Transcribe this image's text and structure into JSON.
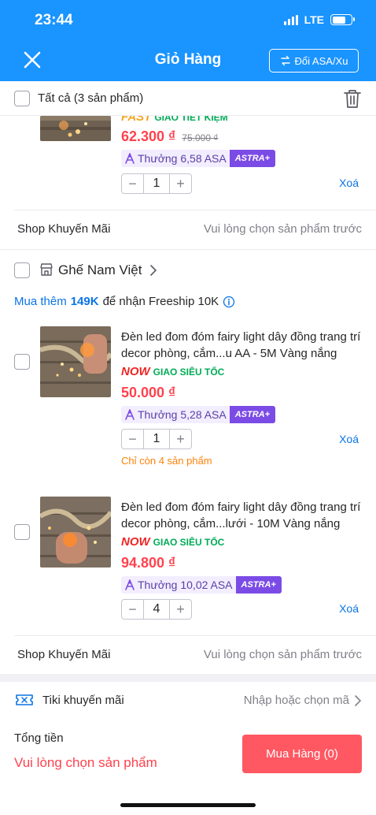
{
  "status": {
    "time": "23:44",
    "network": "LTE"
  },
  "header": {
    "title": "Giỏ Hàng",
    "exchange_label": "Đổi ASA/Xu"
  },
  "select_all": {
    "label": "Tất cả (3 sản phẩm)"
  },
  "colors": {
    "brand_blue": "#1a94ff",
    "price_red": "#ff424e",
    "link_blue": "#0b74e5",
    "astra_purple": "#7b4be6"
  },
  "items": [
    {
      "delivery_brand": "FAST",
      "delivery_text": "GIAO TIẾT KIỆM",
      "price": "62.300 ₫",
      "old_price": "75.000 ₫",
      "reward": "Thưởng 6,58 ASA",
      "reward_tag": "ASTRA+",
      "quantity": "1",
      "remove": "Xoá"
    },
    {
      "name": "Đèn led đom đóm fairy light dây đồng trang trí decor phòng, cắm...u AA - 5M Vàng nắng",
      "delivery_brand": "NOW",
      "delivery_text": "GIAO SIÊU TỐC",
      "price": "50.000 ₫",
      "reward": "Thưởng 5,28 ASA",
      "reward_tag": "ASTRA+",
      "quantity": "1",
      "remove": "Xoá",
      "stock_note": "Chỉ còn 4 sản phẩm"
    },
    {
      "name": "Đèn led đom đóm fairy light dây đồng trang trí decor phòng, cắm...lưới - 10M Vàng nắng",
      "delivery_brand": "NOW",
      "delivery_text": "GIAO SIÊU TỐC",
      "price": "94.800 ₫",
      "reward": "Thưởng 10,02 ASA",
      "reward_tag": "ASTRA+",
      "quantity": "4",
      "remove": "Xoá"
    }
  ],
  "shop_promo": {
    "label": "Shop Khuyến Mãi",
    "hint": "Vui lòng chọn sản phẩm trước"
  },
  "shop": {
    "name": "Ghế Nam Việt"
  },
  "freeship": {
    "prefix": "Mua thêm",
    "amount": "149K",
    "suffix": "để nhận Freeship 10K"
  },
  "tiki_promo": {
    "label": "Tiki khuyến mãi",
    "hint": "Nhập hoặc chọn mã"
  },
  "footer": {
    "total_label": "Tổng tiền",
    "total_hint": "Vui lòng chọn sản phẩm",
    "buy_label": "Mua Hàng (0)"
  }
}
